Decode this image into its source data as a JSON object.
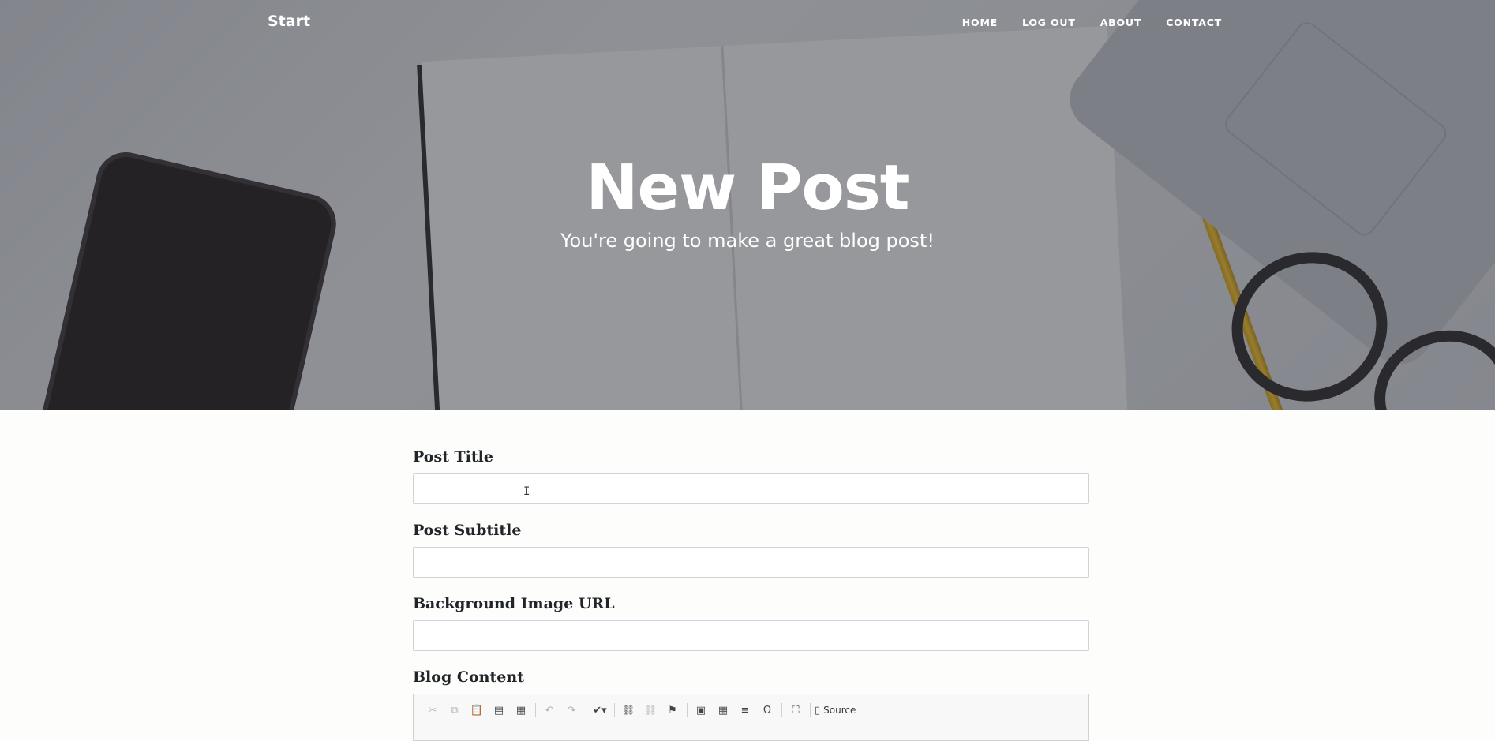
{
  "nav": {
    "brand": "Start",
    "links": [
      "HOME",
      "LOG OUT",
      "ABOUT",
      "CONTACT"
    ]
  },
  "hero": {
    "title": "New Post",
    "subtitle": "You're going to make a great blog post!"
  },
  "form": {
    "title_label": "Post Title",
    "title_value": "",
    "subtitle_label": "Post Subtitle",
    "subtitle_value": "",
    "image_label": "Background Image URL",
    "image_value": "",
    "content_label": "Blog Content"
  },
  "editor": {
    "source_label": "Source",
    "toolbar_icons": [
      "cut-icon",
      "copy-icon",
      "paste-icon",
      "paste-text-icon",
      "paste-word-icon",
      "undo-icon",
      "redo-icon",
      "spellcheck-icon",
      "link-icon",
      "unlink-icon",
      "anchor-icon",
      "image-icon",
      "table-icon",
      "horizontal-rule-icon",
      "special-char-icon",
      "maximize-icon",
      "source-icon"
    ]
  }
}
